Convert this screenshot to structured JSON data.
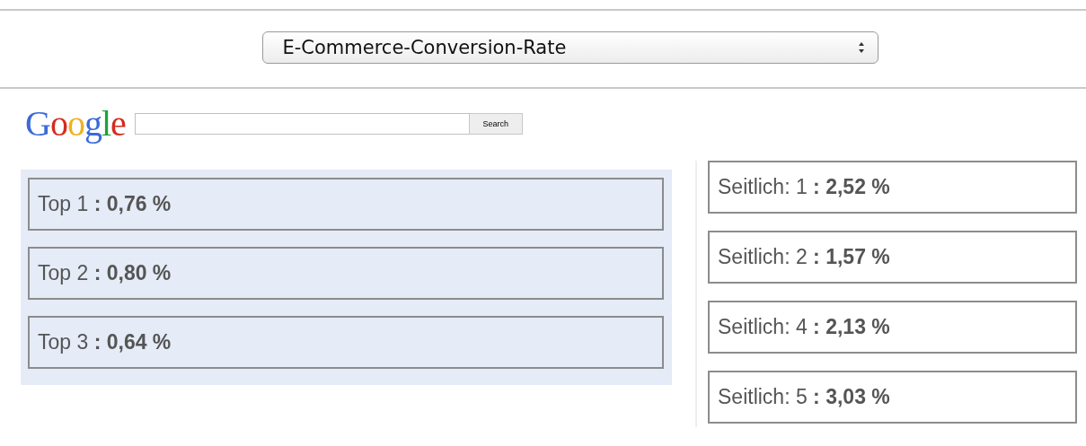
{
  "metric_select": {
    "value": "E-Commerce-Conversion-Rate"
  },
  "search": {
    "logo": "Google",
    "button": "Search"
  },
  "top_ads": [
    "Top 1 **: 0,76 %**",
    "Top 2 **: 0,80 %**",
    "Top 3 **: 0,64 %**"
  ],
  "side_ads": [
    "Seitlich: 1 **: 2,52 %**",
    "Seitlich: 2 **: 1,57 %**",
    "Seitlich: 4 **: 2,13 %**",
    "Seitlich: 5 **: 3,03 %**"
  ]
}
